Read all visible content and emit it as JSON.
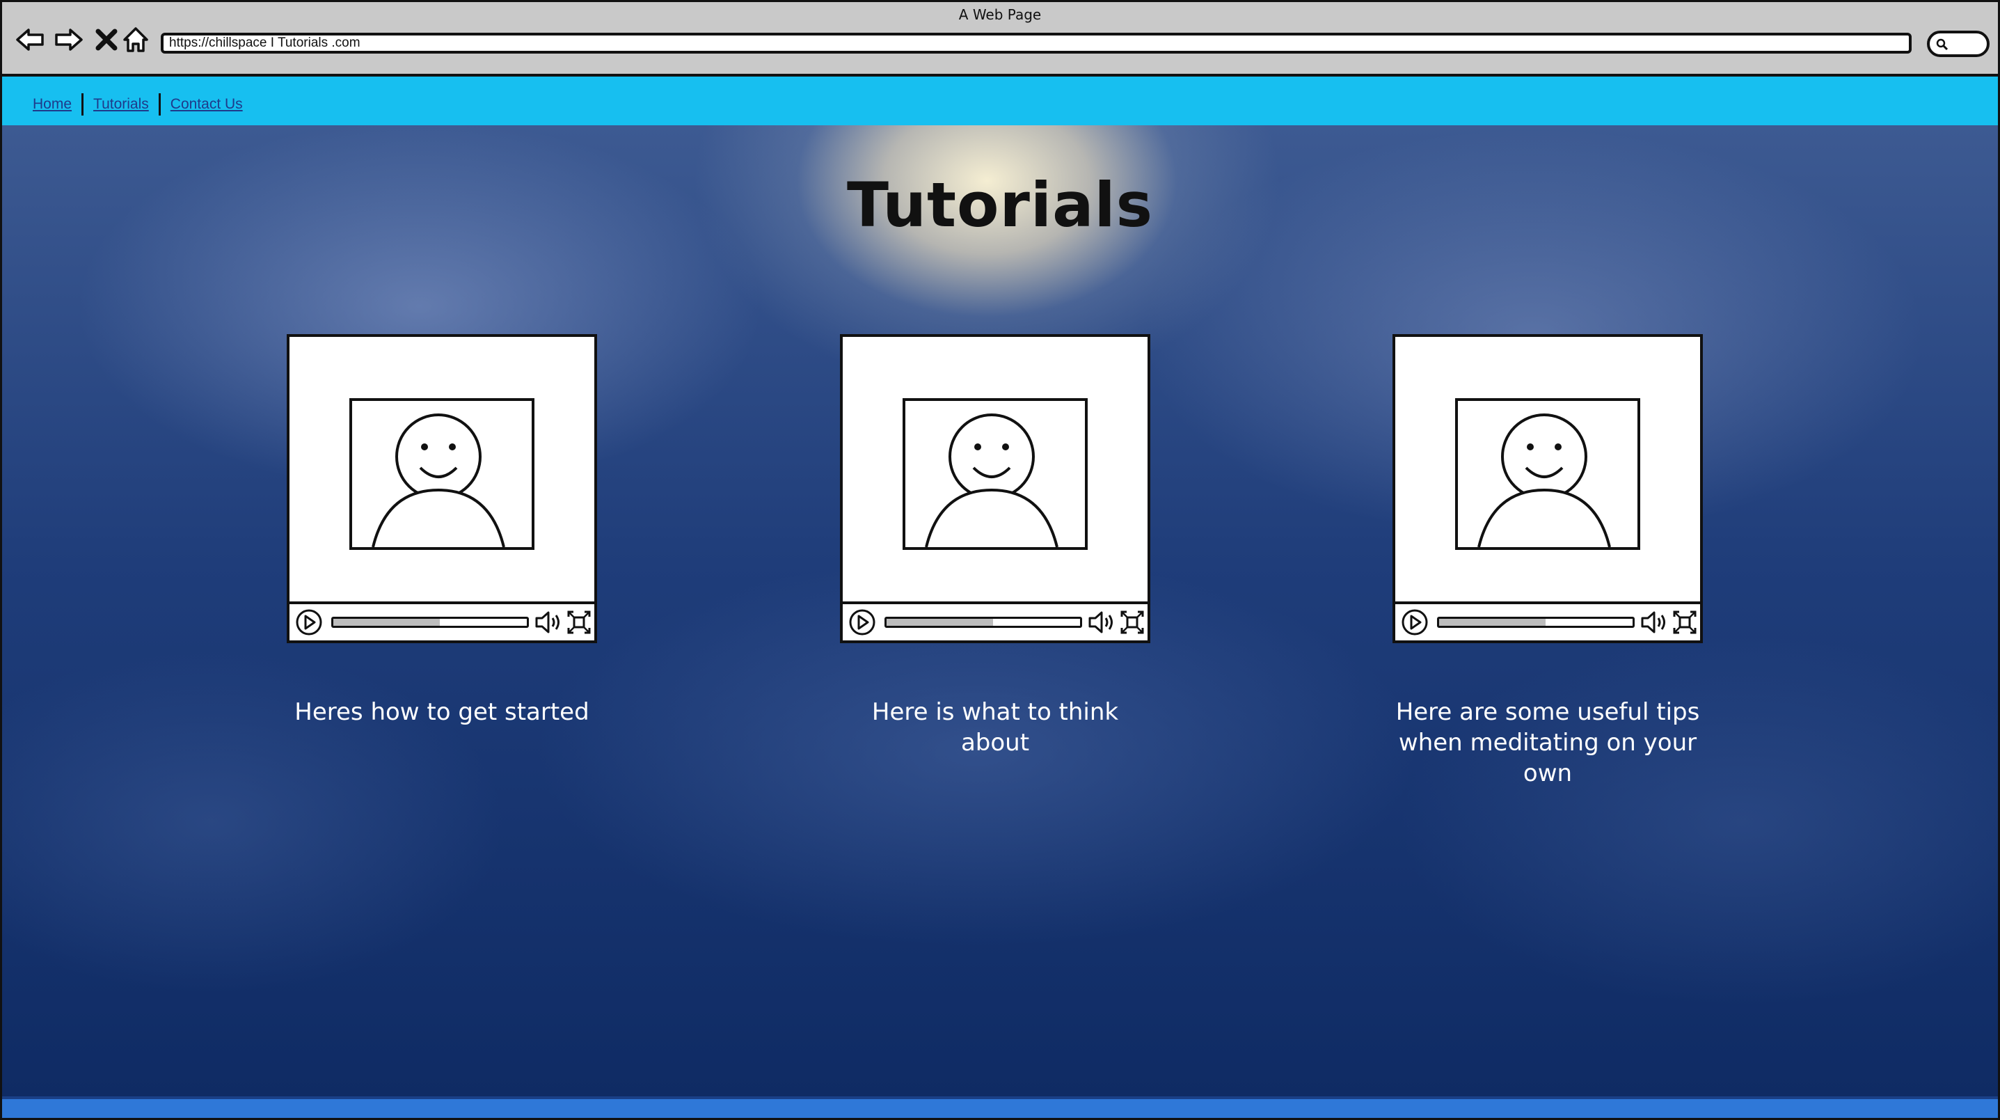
{
  "window": {
    "title": "A Web Page"
  },
  "toolbar": {
    "url": "https://chillspace I Tutorials .com",
    "icons": [
      "back-arrow-icon",
      "forward-arrow-icon",
      "close-icon",
      "home-icon",
      "search-icon"
    ]
  },
  "nav": {
    "items": [
      {
        "label": "Home"
      },
      {
        "label": "Tutorials"
      },
      {
        "label": "Contact Us"
      }
    ]
  },
  "page": {
    "title": "Tutorials"
  },
  "videos": [
    {
      "caption": "Heres how to get started",
      "progress": 0.55
    },
    {
      "caption": "Here is what to think about",
      "progress": 0.55
    },
    {
      "caption": "Here are some useful tips when meditating on your own",
      "progress": 0.55
    }
  ],
  "colors": {
    "navbar": "#17bff0",
    "bottom_bar": "#2f78d8",
    "chrome": "#c9c9c9"
  }
}
